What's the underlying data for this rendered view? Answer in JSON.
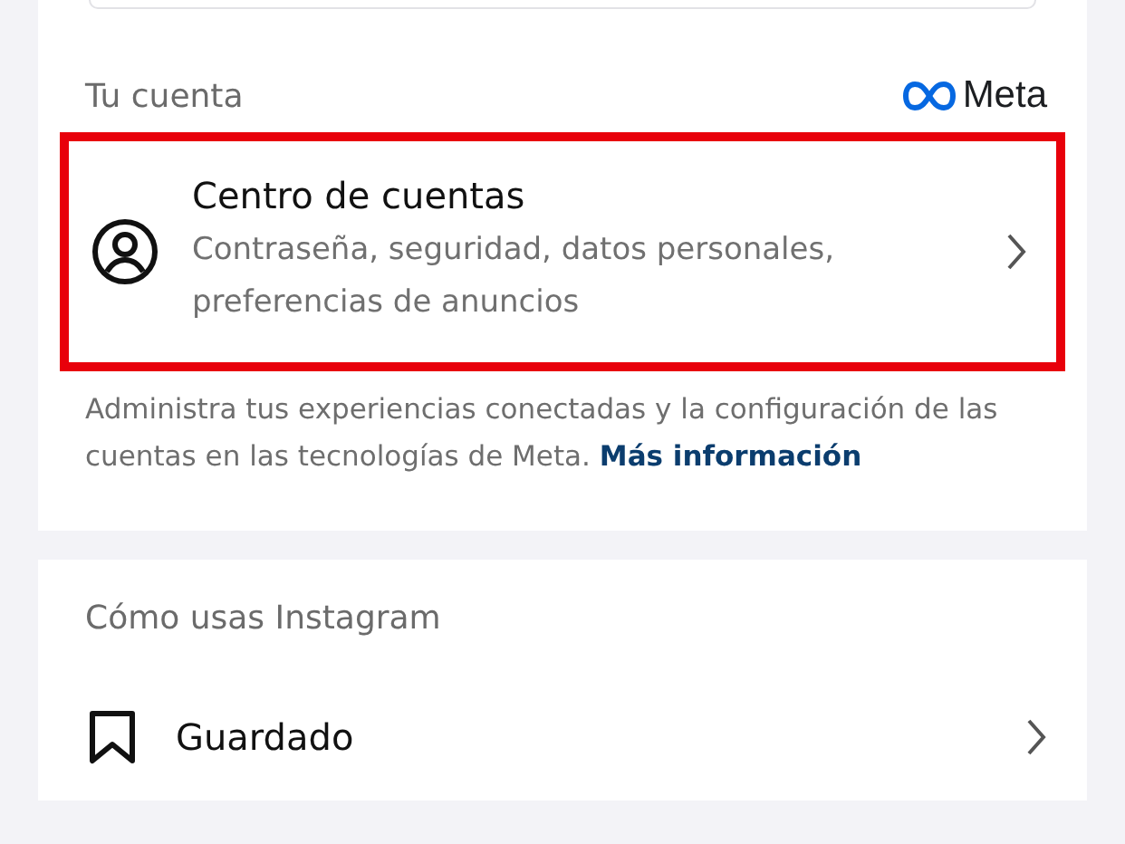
{
  "account_section": {
    "heading": "Tu cuenta",
    "brand": "Meta",
    "item": {
      "title": "Centro de cuentas",
      "subtitle": "Contraseña, seguridad, datos personales, preferencias de anuncios",
      "highlighted": true
    },
    "description": "Administra tus experiencias conectadas y la configuración de las cuentas en las tecnologías de Meta.",
    "link": "Más información"
  },
  "usage_section": {
    "heading": "Cómo usas Instagram",
    "items": [
      {
        "label": "Guardado"
      }
    ]
  }
}
